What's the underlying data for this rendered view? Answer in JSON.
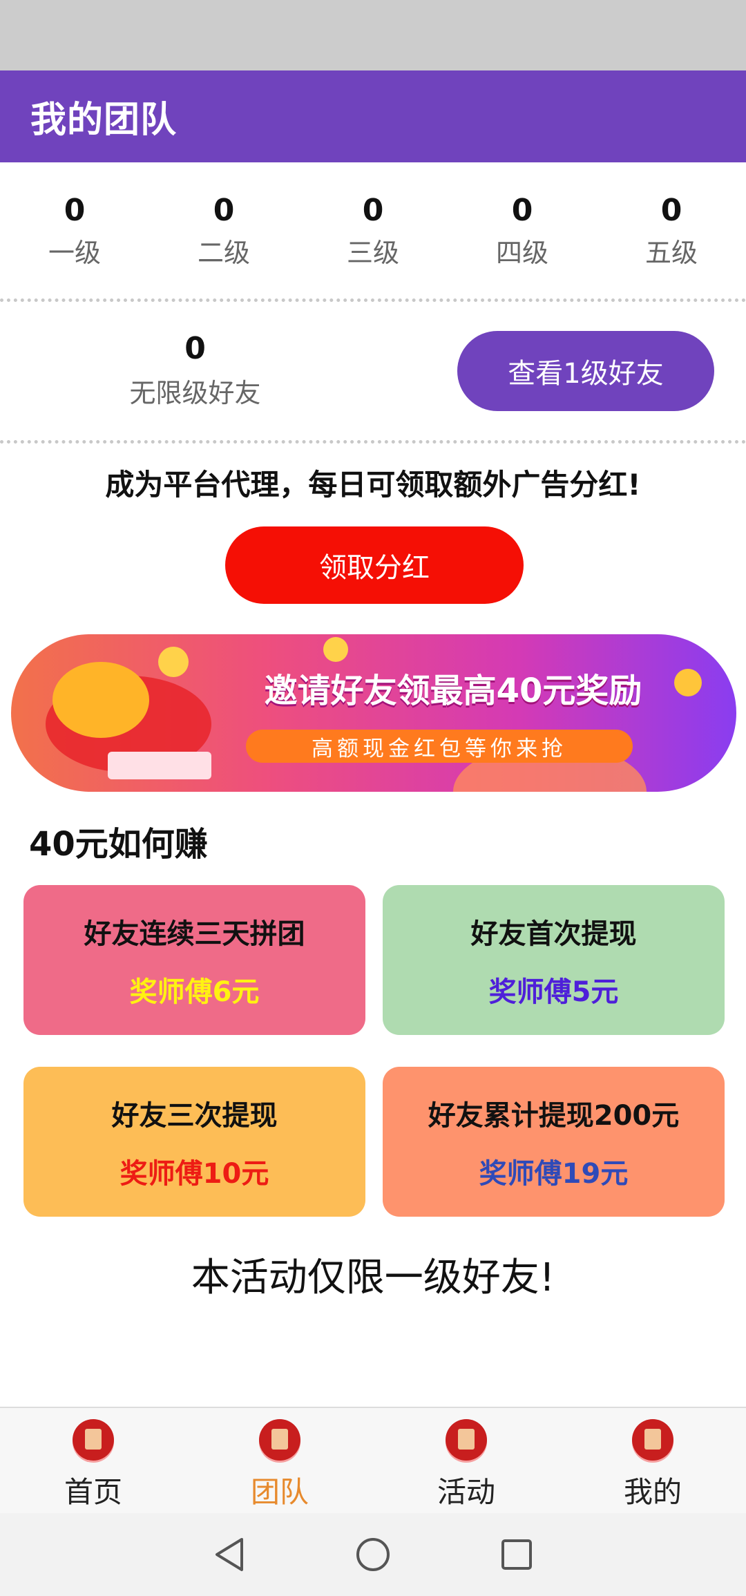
{
  "header": {
    "title": "我的团队"
  },
  "levels": [
    {
      "count": "0",
      "label": "一级"
    },
    {
      "count": "0",
      "label": "二级"
    },
    {
      "count": "0",
      "label": "三级"
    },
    {
      "count": "0",
      "label": "四级"
    },
    {
      "count": "0",
      "label": "五级"
    }
  ],
  "unlimited": {
    "count": "0",
    "label": "无限级好友",
    "button": "查看1级好友"
  },
  "promo": {
    "text": "成为平台代理，每日可领取额外广告分红!",
    "button": "领取分红"
  },
  "banner": {
    "title": "邀请好友领最高40元奖励",
    "subtitle": "高额现金红包等你来抢"
  },
  "earn": {
    "title": "40元如何赚",
    "cards": [
      {
        "title": "好友连续三天拼团",
        "reward": "奖师傅6元",
        "color": "#ef6b88"
      },
      {
        "title": "好友首次提现",
        "reward": "奖师傅5元",
        "color": "#afdbb0"
      },
      {
        "title": "好友三次提现",
        "reward": "奖师傅10元",
        "color": "#fdbd56"
      },
      {
        "title": "好友累计提现200元",
        "reward": "奖师傅19元",
        "color": "#fe936d"
      }
    ]
  },
  "note": "本活动仅限一级好友!",
  "tabs": [
    {
      "label": "首页",
      "icon": "home-icon",
      "active": false
    },
    {
      "label": "团队",
      "icon": "team-icon",
      "active": true
    },
    {
      "label": "活动",
      "icon": "activity-icon",
      "active": false
    },
    {
      "label": "我的",
      "icon": "profile-icon",
      "active": false
    }
  ],
  "colors": {
    "accent": "#7043bd",
    "claim": "#f50f05",
    "active_tab": "#e78a2d"
  }
}
